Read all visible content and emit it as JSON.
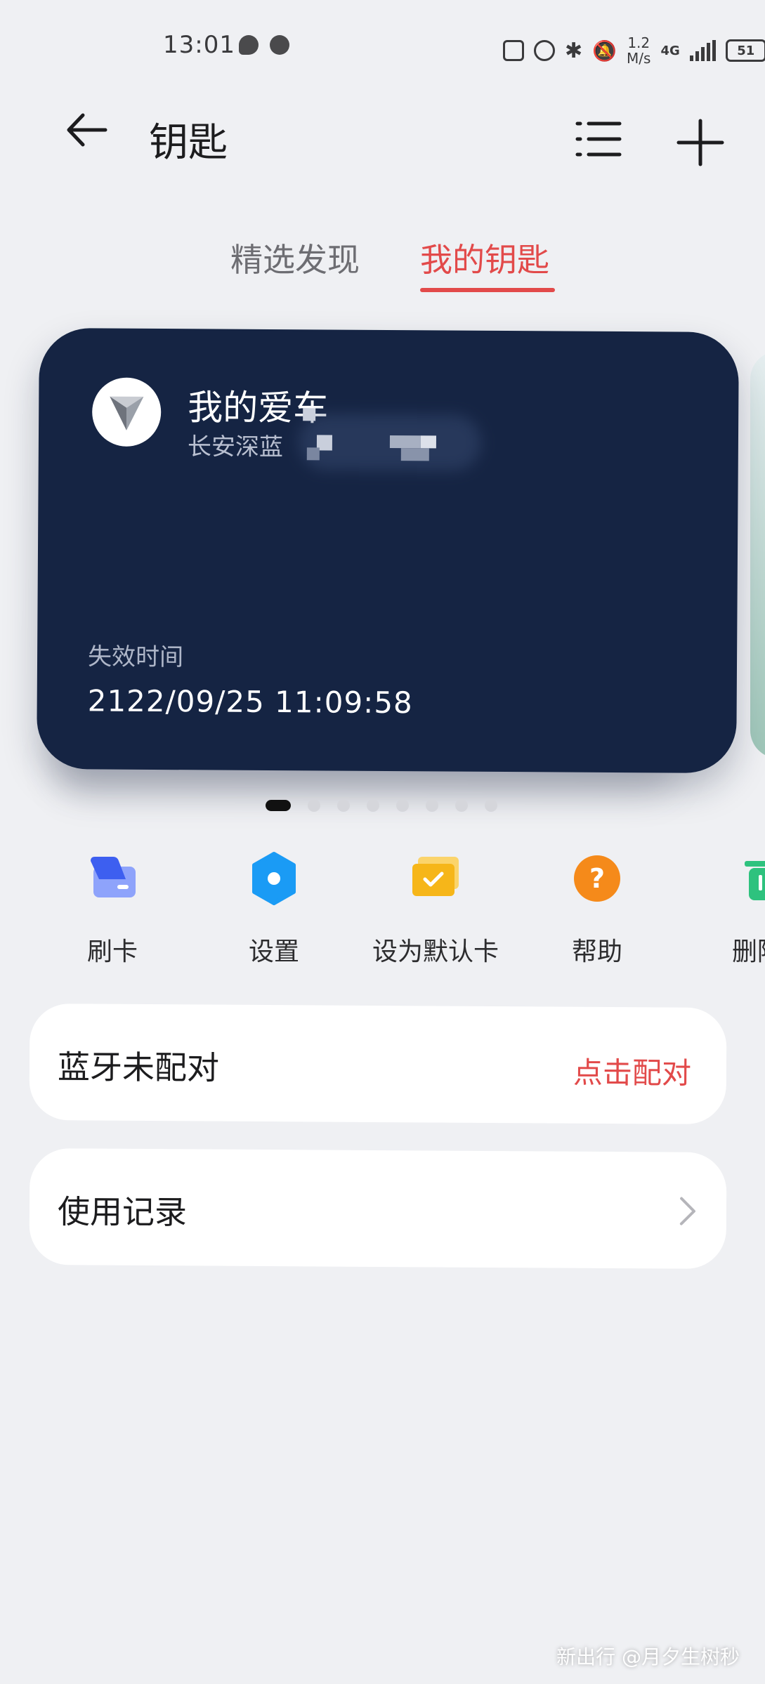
{
  "status_bar": {
    "time": "13:01",
    "speed_value": "1.2",
    "speed_unit": "M/s",
    "network": "4G",
    "battery": "51"
  },
  "header": {
    "title": "钥匙",
    "icons": [
      "back-arrow-icon",
      "list-icon",
      "plus-icon"
    ]
  },
  "tabs": [
    {
      "label": "精选发现",
      "active": false
    },
    {
      "label": "我的钥匙",
      "active": true
    }
  ],
  "card": {
    "name": "我的爱车",
    "model": "长安深蓝",
    "expire_label": "失效时间",
    "expire_time": "2122/09/25 11:09:58",
    "background_color": "#152443"
  },
  "pager": {
    "count": 8,
    "active_index": 0
  },
  "actions": [
    {
      "label": "刷卡",
      "icon": "card-swipe-icon",
      "color": "#5b7cf5"
    },
    {
      "label": "设置",
      "icon": "settings-icon",
      "color": "#1a9bf5"
    },
    {
      "label": "设为默认卡",
      "icon": "default-card-icon",
      "color": "#f6b619"
    },
    {
      "label": "帮助",
      "icon": "help-icon",
      "color": "#f58a1a"
    },
    {
      "label": "删除",
      "icon": "delete-icon",
      "color": "#2ec27e"
    }
  ],
  "bluetooth": {
    "label": "蓝牙未配对",
    "action": "点击配对"
  },
  "records": {
    "label": "使用记录"
  },
  "watermark": "新出行 @月夕生树秒",
  "accent_color": "#e24a4a"
}
